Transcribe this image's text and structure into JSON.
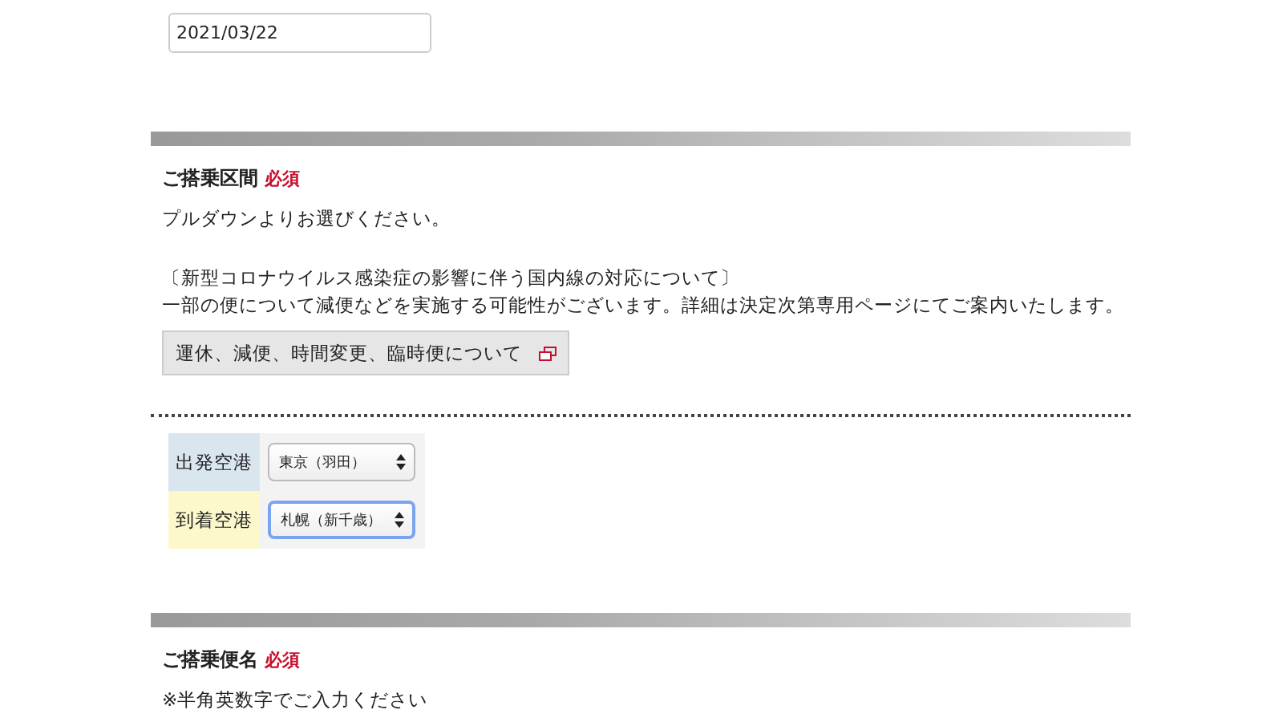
{
  "date_field": {
    "value": "2021/03/22"
  },
  "route_section": {
    "title": "ご搭乗区間",
    "required": "必須",
    "instruction": "プルダウンよりお選びください。",
    "notice_heading": "〔新型コロナウイルス感染症の影響に伴う国内線の対応について〕",
    "notice_body": "一部の便について減便などを実施する可能性がございます。詳細は決定次第専用ページにてご案内いたします。",
    "link_button": "運休、減便、時間変更、臨時便について"
  },
  "airports": [
    {
      "label": "出発空港",
      "value": "東京（羽田）",
      "color": "#dae6ee",
      "focused": false
    },
    {
      "label": "到着空港",
      "value": "札幌（新千歳）",
      "color": "#fdf8cc",
      "focused": true
    }
  ],
  "flight_section": {
    "title": "ご搭乗便名",
    "required": "必須",
    "instruction": "※半角英数字でご入力ください"
  }
}
